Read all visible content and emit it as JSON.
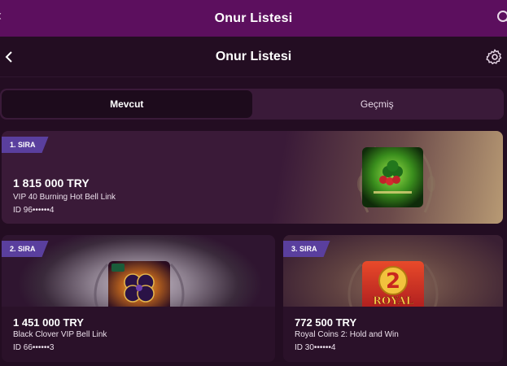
{
  "topbar": {
    "title": "Onur Listesi"
  },
  "header": {
    "title": "Onur Listesi"
  },
  "tabs": [
    {
      "label": "Mevcut",
      "active": true
    },
    {
      "label": "Geçmiş",
      "active": false
    }
  ],
  "leaders": [
    {
      "rank_label": "1. SIRA",
      "amount": "1 815 000 TRY",
      "game": "VIP 40 Burning Hot Bell Link",
      "user_id": "ID 96••••••4"
    },
    {
      "rank_label": "2. SIRA",
      "amount": "1 451 000 TRY",
      "game": "Black Clover VIP Bell Link",
      "user_id": "ID 66••••••3"
    },
    {
      "rank_label": "3. SIRA",
      "amount": "772 500 TRY",
      "game": "Royal Coins 2: Hold and Win",
      "user_id": "ID 30••••••4"
    }
  ],
  "thumbnails": {
    "game3_big_text": "2",
    "game3_logo_text": "ROYAL"
  },
  "colors": {
    "topbar": "#5c0f5e",
    "background": "#230d22",
    "badge": "#5a3f9e",
    "tabs_bg": "#3a1a39",
    "tab_active": "#1d0b1c"
  },
  "icons": {
    "back": "chevron-left-icon",
    "search": "search-icon",
    "settings": "gear-icon"
  }
}
